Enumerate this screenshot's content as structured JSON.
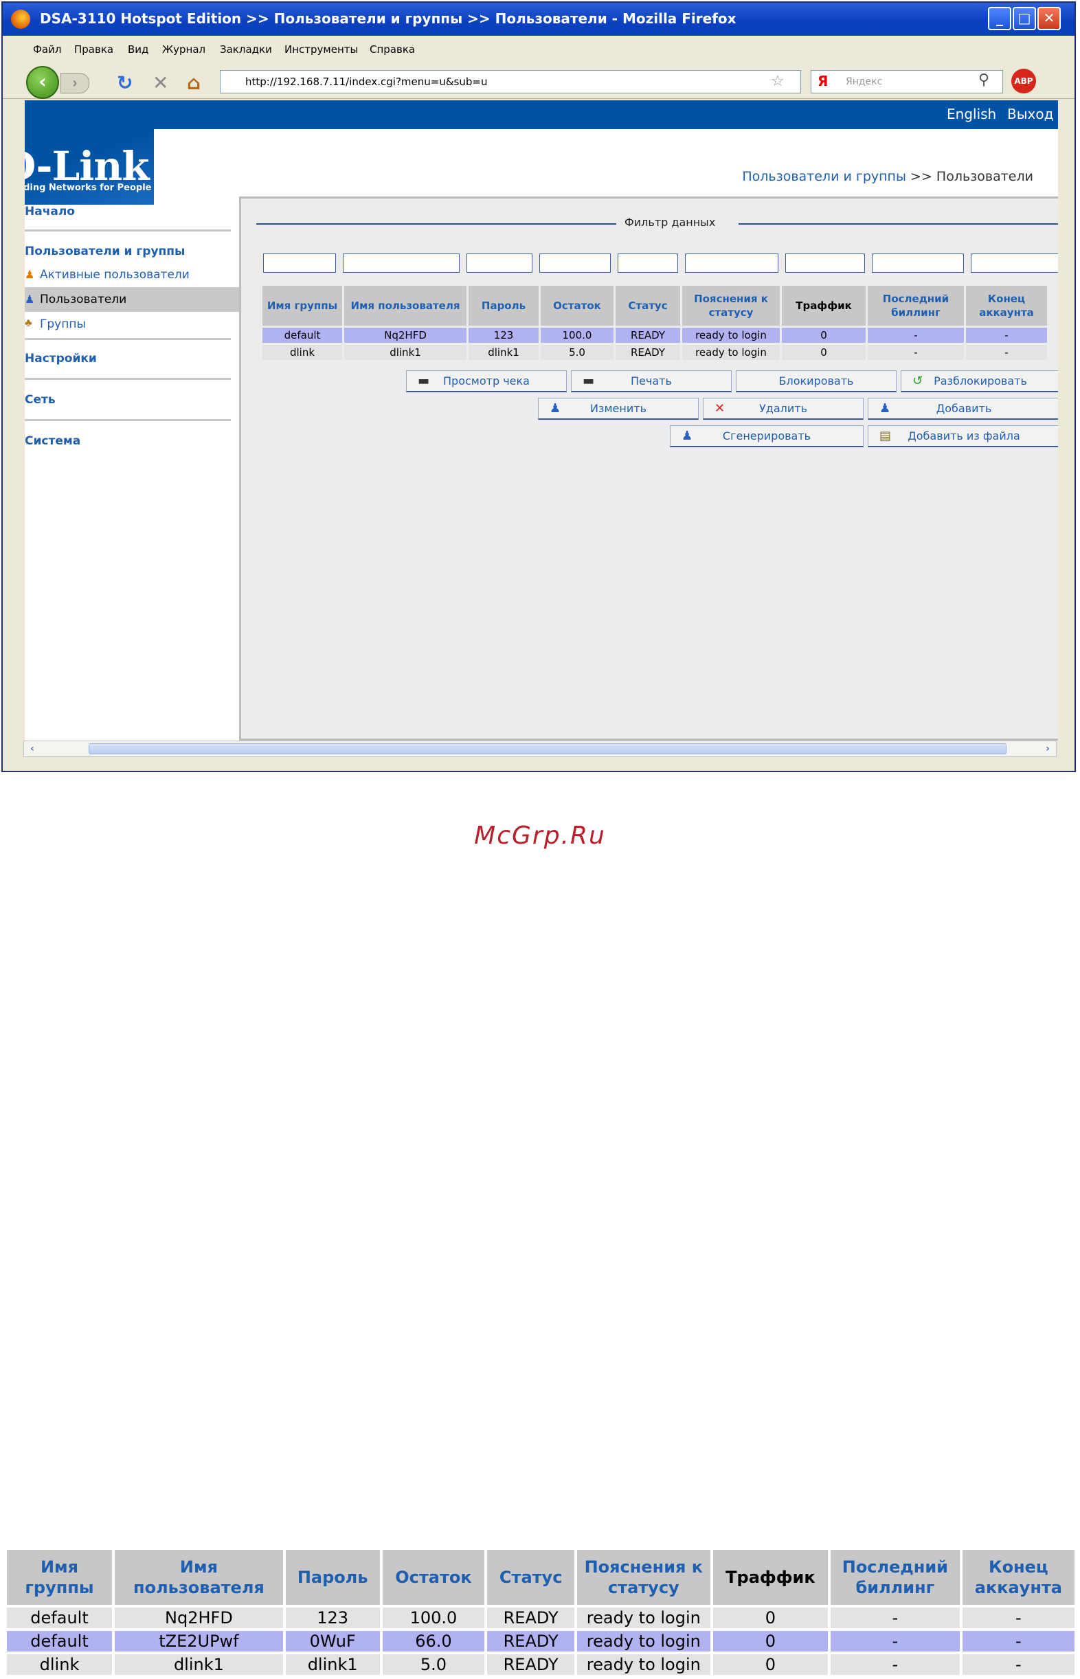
{
  "window": {
    "title": "DSA-3110 Hotspot Edition >> Пользователи и группы >> Пользователи - Mozilla Firefox",
    "controls": {
      "minimize": "_",
      "maximize": "□",
      "close": "✕"
    }
  },
  "menu": [
    "Файл",
    "Правка",
    "Вид",
    "Журнал",
    "Закладки",
    "Инструменты",
    "Справка"
  ],
  "nav": {
    "url": "http://192.168.7.11/index.cgi?menu=u&sub=u",
    "search_placeholder": "Яндекс",
    "search_engine": "Я",
    "abp": "ABP"
  },
  "header": {
    "lang": "English",
    "logout": "Выход"
  },
  "logo": {
    "text": "D-Link",
    "tagline": "Building Networks for People"
  },
  "breadcrumb": {
    "parent": "Пользователи и группы",
    "sep": ">>",
    "current": "Пользователи"
  },
  "sidebar": {
    "home": "Начало",
    "users_groups": "Пользователи и группы",
    "active_users": "Активные пользователи",
    "users": "Пользователи",
    "groups": "Группы",
    "settings": "Настройки",
    "network": "Сеть",
    "system": "Система"
  },
  "filter": {
    "legend": "Фильтр данных"
  },
  "table": {
    "headers": [
      "Имя группы",
      "Имя пользователя",
      "Пароль",
      "Остаток",
      "Статус",
      "Пояснения к статусу",
      "Траффик",
      "Последний биллинг",
      "Конец аккаунта"
    ],
    "rows": [
      [
        "default",
        "Nq2HFD",
        "123",
        "100.0",
        "READY",
        "ready to login",
        "0",
        "-",
        "-"
      ],
      [
        "dlink",
        "dlink1",
        "dlink1",
        "5.0",
        "READY",
        "ready to login",
        "0",
        "-",
        "-"
      ]
    ]
  },
  "buttons": {
    "view_receipt": "Просмотр чека",
    "print": "Печать",
    "block": "Блокировать",
    "unblock": "Разблокировать",
    "edit": "Изменить",
    "delete": "Удалить",
    "add": "Добавить",
    "generate": "Сгенерировать",
    "add_from_file": "Добавить из файла"
  },
  "watermark": "McGrp.Ru",
  "bottom_table": {
    "headers": [
      "Имя группы",
      "Имя пользователя",
      "Пароль",
      "Остаток",
      "Статус",
      "Пояснения к статусу",
      "Траффик",
      "Последний биллинг",
      "Конец аккаунта"
    ],
    "rows": [
      [
        "default",
        "Nq2HFD",
        "123",
        "100.0",
        "READY",
        "ready to login",
        "0",
        "-",
        "-"
      ],
      [
        "default",
        "tZE2UPwf",
        "0WuF",
        "66.0",
        "READY",
        "ready to login",
        "0",
        "-",
        "-"
      ],
      [
        "dlink",
        "dlink1",
        "dlink1",
        "5.0",
        "READY",
        "ready to login",
        "0",
        "-",
        "-"
      ]
    ]
  }
}
